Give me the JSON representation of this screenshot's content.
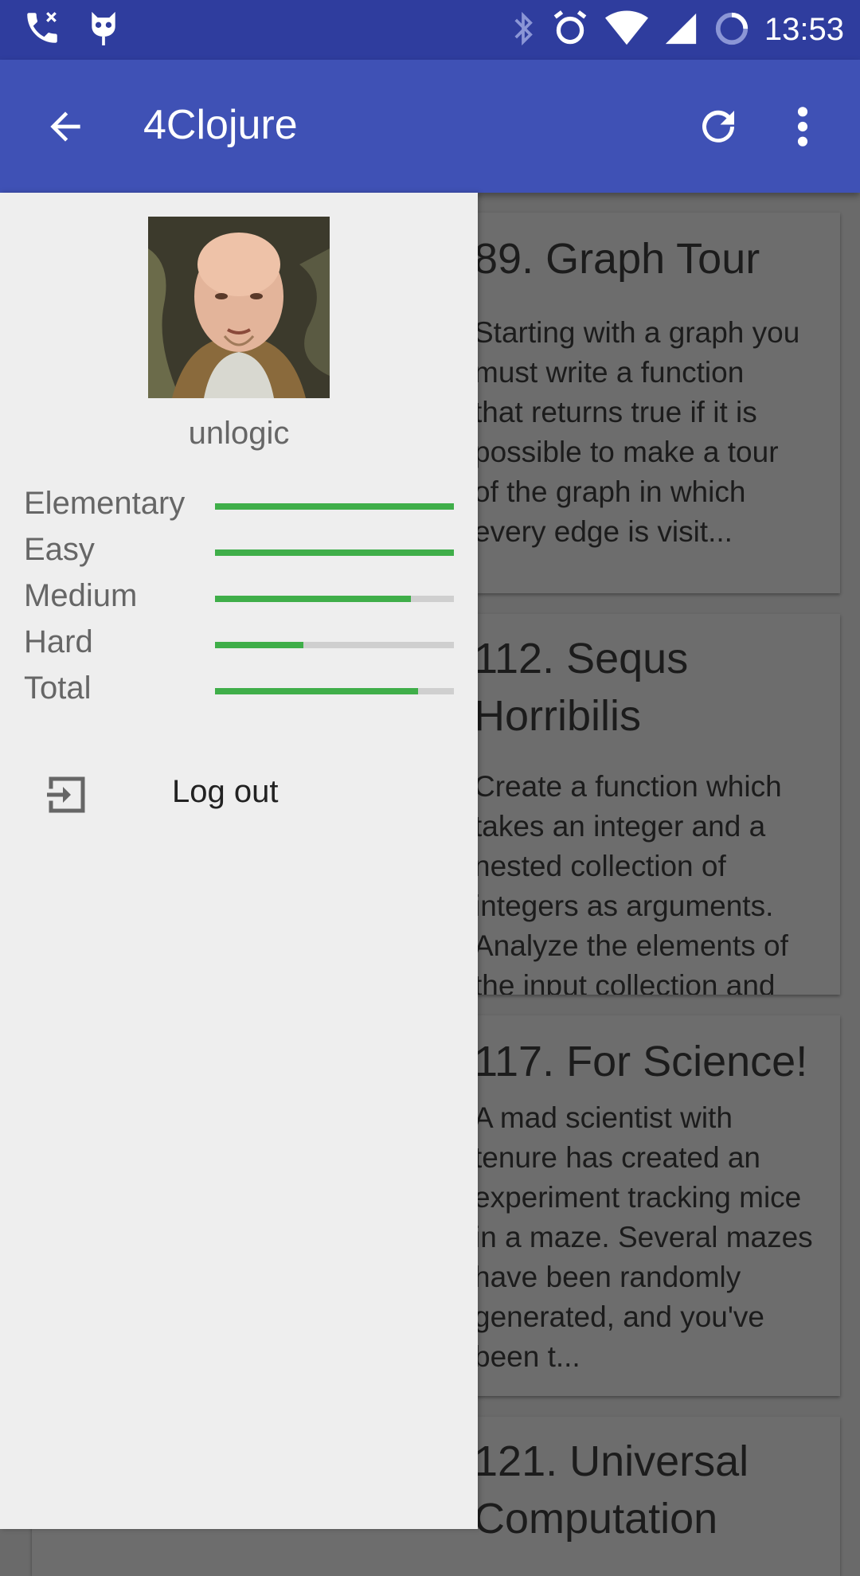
{
  "status_bar": {
    "time": "13:53",
    "icons": [
      "missed-call-icon",
      "cyanogen-icon",
      "bluetooth-icon",
      "alarm-icon",
      "wifi-icon",
      "signal-icon",
      "battery-icon"
    ]
  },
  "app_bar": {
    "title": "4Clojure",
    "back_icon": "arrow-back-icon",
    "refresh_icon": "refresh-icon",
    "more_icon": "more-vert-icon",
    "color": "#3f51b5"
  },
  "problems": [
    {
      "title": "89. Graph Tour",
      "desc": "Starting with a graph you\nmust write a function\nthat returns true if it is\npossible to make a tour\nof the graph in which\nevery edge is visit..."
    },
    {
      "title": "112. Sequs\nHorribilis",
      "desc": "Create a function which\ntakes an integer and a\nnested collection of\nintegers as arguments.\nAnalyze the elements of\nthe input collection and"
    },
    {
      "title": "117. For Science!",
      "desc": "A mad scientist with\ntenure has created an\nexperiment tracking mice\nin a maze. Several mazes\nhave been randomly\ngenerated, and you've\nbeen t..."
    },
    {
      "title": "121. Universal\nComputation",
      "desc": ""
    }
  ],
  "drawer": {
    "username": "unlogic",
    "stats": [
      {
        "label": "Elementary",
        "progress": 1.0
      },
      {
        "label": "Easy",
        "progress": 1.0
      },
      {
        "label": "Medium",
        "progress": 0.82
      },
      {
        "label": "Hard",
        "progress": 0.37
      },
      {
        "label": "Total",
        "progress": 0.85
      }
    ],
    "progress_color": "#3fae49",
    "logout_label": "Log out",
    "logout_icon": "exit-to-app-icon"
  }
}
